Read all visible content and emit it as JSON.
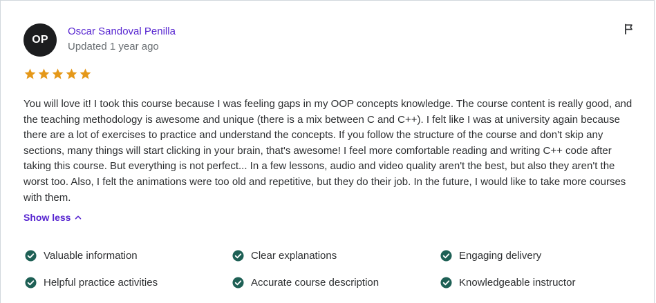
{
  "reviewer": {
    "initials": "OP",
    "name": "Oscar Sandoval Penilla",
    "updated": "Updated 1 year ago"
  },
  "rating": 5,
  "review_text": "You will love it! I took this course because I was feeling gaps in my OOP concepts knowledge. The course content is really good, and the teaching methodology is awesome and unique (there is a mix between C and C++). I felt like I was at university again because there are a lot of exercises to practice and understand the concepts. If you follow the structure of the course and don't skip any sections, many things will start clicking in your brain, that's awesome! I feel more comfortable reading and writing C++ code after taking this course. But everything is not perfect... In a few lessons, audio and video quality aren't the best, but also they aren't the worst too. Also, I felt the animations were too old and repetitive, but they do their job. In the future, I would like to take more courses with them.",
  "show_less_label": "Show less",
  "tags": [
    "Valuable information",
    "Clear explanations",
    "Engaging delivery",
    "Helpful practice activities",
    "Accurate course description",
    "Knowledgeable instructor"
  ],
  "colors": {
    "star": "#e59819",
    "check": "#1e6055",
    "link": "#5624d0",
    "avatar_bg": "#1c1d1f"
  },
  "icons": {
    "flag": "flag-icon",
    "star": "star-icon",
    "check": "check-circle-icon",
    "chevron": "chevron-up-icon"
  }
}
